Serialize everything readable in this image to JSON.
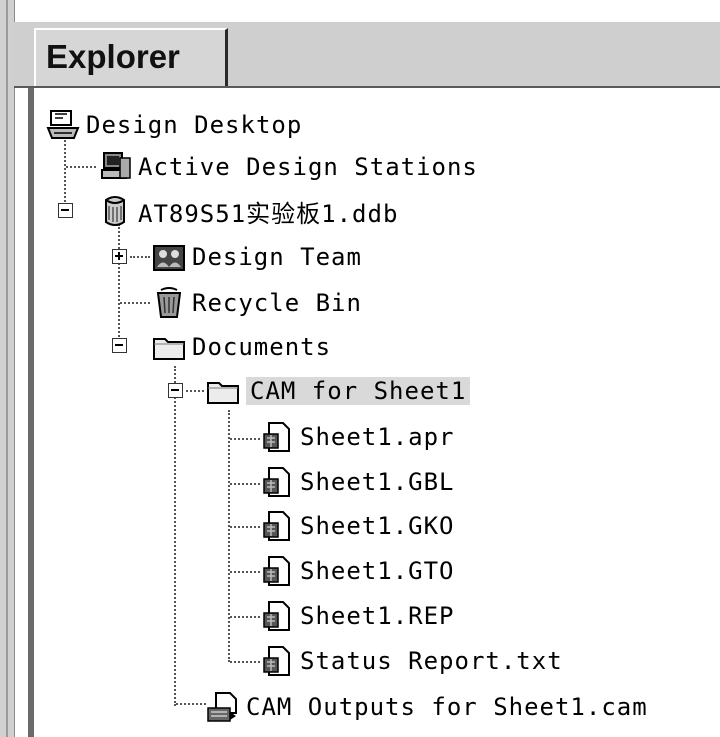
{
  "tab": {
    "label": "Explorer"
  },
  "tree": {
    "root": {
      "label": "Design Desktop",
      "icon": "desktop-icon"
    },
    "active_stations": {
      "label": "Active Design Stations",
      "icon": "workstation-icon"
    },
    "database": {
      "label": "AT89S51实验板1.ddb",
      "icon": "database-icon",
      "expanded": true
    },
    "design_team": {
      "label": "Design Team",
      "icon": "team-icon",
      "expanded": false
    },
    "recycle_bin": {
      "label": "Recycle Bin",
      "icon": "recycle-bin-icon"
    },
    "documents": {
      "label": "Documents",
      "icon": "folder-icon",
      "expanded": true
    },
    "cam_folder": {
      "label": "CAM for Sheet1",
      "icon": "folder-open-icon",
      "expanded": true,
      "selected": true
    },
    "cam_files": [
      {
        "label": "Sheet1.apr",
        "icon": "cam-file-icon"
      },
      {
        "label": "Sheet1.GBL",
        "icon": "cam-file-icon"
      },
      {
        "label": "Sheet1.GKO",
        "icon": "cam-file-icon"
      },
      {
        "label": "Sheet1.GTO",
        "icon": "cam-file-icon"
      },
      {
        "label": "Sheet1.REP",
        "icon": "cam-file-icon"
      },
      {
        "label": "Status Report.txt",
        "icon": "cam-file-icon"
      }
    ],
    "cam_outputs": {
      "label": "CAM Outputs for Sheet1.cam",
      "icon": "cam-output-icon"
    }
  }
}
